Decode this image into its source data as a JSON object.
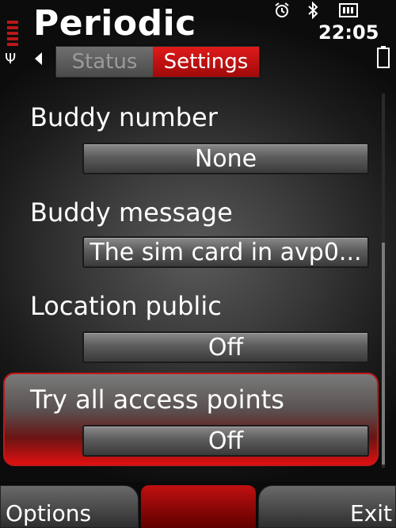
{
  "header": {
    "title": "Periodic",
    "clock": "22:05"
  },
  "tabs": [
    {
      "label": "Status",
      "active": false
    },
    {
      "label": "Settings",
      "active": true
    }
  ],
  "settings": [
    {
      "label": "Buddy number",
      "value": "None"
    },
    {
      "label": "Buddy message",
      "value": "The sim card in avp0..."
    },
    {
      "label": "Location public",
      "value": "Off"
    },
    {
      "label": "Try all access points",
      "value": "Off",
      "selected": true
    }
  ],
  "softkeys": {
    "left": "Options",
    "right": "Exit"
  },
  "colors": {
    "accent": "#e01a1a",
    "background": "#2a2a2a"
  },
  "icons": [
    "signal-icon",
    "alarm-icon",
    "bluetooth-icon",
    "keyboard-icon",
    "battery-icon"
  ]
}
